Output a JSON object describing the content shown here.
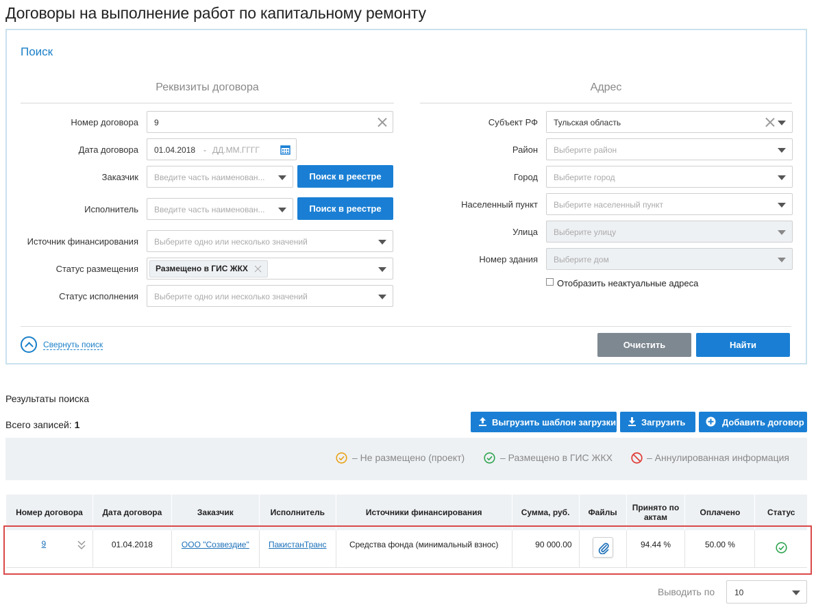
{
  "page_title": "Договоры на выполнение работ по капитальному ремонту",
  "search": {
    "title": "Поиск",
    "contract_section": "Реквизиты договора",
    "address_section": "Адрес",
    "contract_number": {
      "label": "Номер договора",
      "value": "9"
    },
    "contract_date": {
      "label": "Дата договора",
      "from": "01.04.2018",
      "separator": "-",
      "to_placeholder": "ДД.ММ.ГГГГ"
    },
    "customer": {
      "label": "Заказчик",
      "placeholder": "Введите часть наименован...",
      "button": "Поиск в реестре"
    },
    "contractor": {
      "label": "Исполнитель",
      "placeholder": "Введите часть наименован...",
      "button": "Поиск в реестре"
    },
    "funding_source": {
      "label": "Источник финансирования",
      "placeholder": "Выберите одно или несколько значений"
    },
    "placement_status": {
      "label": "Статус размещения",
      "tag": "Размещено в ГИС ЖКХ"
    },
    "execution_status": {
      "label": "Статус исполнения",
      "placeholder": "Выберите одно или несколько значений"
    },
    "region": {
      "label": "Субъект РФ",
      "value": "Тульская область"
    },
    "district": {
      "label": "Район",
      "placeholder": "Выберите район"
    },
    "city": {
      "label": "Город",
      "placeholder": "Выберите город"
    },
    "settlement": {
      "label": "Населенный пункт",
      "placeholder": "Выберите населенный пункт"
    },
    "street": {
      "label": "Улица",
      "placeholder": "Выберите улицу"
    },
    "building": {
      "label": "Номер здания",
      "placeholder": "Выберите дом"
    },
    "show_inactive": "Отобразить неактуальные адреса",
    "collapse": "Свернуть поиск",
    "clear": "Очистить",
    "find": "Найти"
  },
  "results": {
    "title": "Результаты поиска",
    "total_label": "Всего записей:",
    "total_value": "1",
    "export_template": "Выгрузить шаблон загрузки",
    "upload": "Загрузить",
    "add_contract": "Добавить договор",
    "legend": {
      "draft": "–  Не размещено (проект)",
      "placed": "–  Размещено в ГИС ЖКХ",
      "annulled": "–  Аннулированная информация"
    },
    "columns": [
      "Номер договора",
      "Дата договора",
      "Заказчик",
      "Исполнитель",
      "Источники финансирования",
      "Сумма, руб.",
      "Файлы",
      "Принято по актам",
      "Оплачено",
      "Статус"
    ],
    "rows": [
      {
        "number": "9",
        "date": "01.04.2018",
        "customer": "ООО \"Созвездие\"",
        "contractor": "ПакистанТранс",
        "funding": "Средства фонда (минимальный взнос)",
        "amount": "90 000.00",
        "accepted": "94.44 %",
        "paid": "50.00 %"
      }
    ],
    "page_size_label": "Выводить по",
    "page_size": "10"
  },
  "colors": {
    "accent": "#1a7fd4",
    "placed": "#2ea44f",
    "draft": "#e8a317",
    "annulled": "#e0413a",
    "highlight": "#d94848"
  }
}
